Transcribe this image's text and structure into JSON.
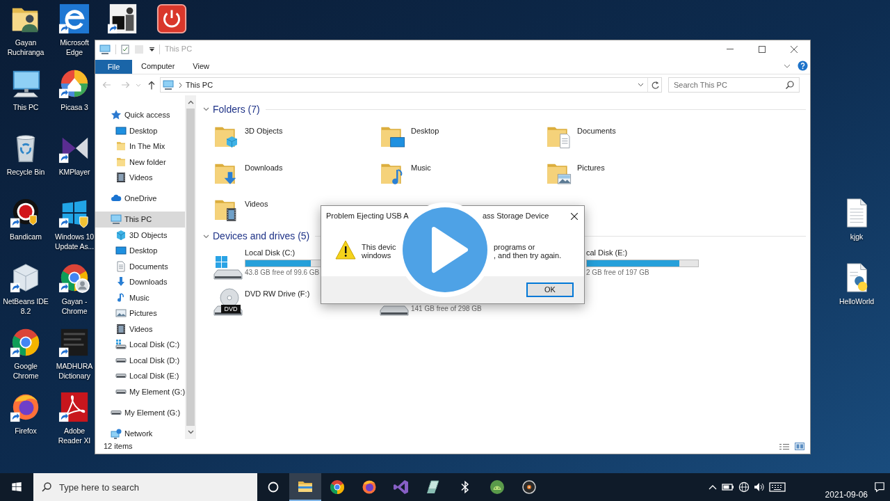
{
  "desktop": {
    "column_1": [
      {
        "label": "Gayan Ruchiranga",
        "kind": "user-folder",
        "shortcut": false
      },
      {
        "label": "This PC",
        "kind": "computer",
        "shortcut": false
      },
      {
        "label": "Recycle Bin",
        "kind": "recycle-bin",
        "shortcut": false
      },
      {
        "label": "Bandicam",
        "kind": "record",
        "shortcut": true
      },
      {
        "label": "NetBeans IDE 8.2",
        "kind": "cube",
        "shortcut": true
      },
      {
        "label": "Google Chrome",
        "kind": "browser",
        "shortcut": true
      },
      {
        "label": "Firefox",
        "kind": "fox",
        "shortcut": true
      }
    ],
    "column_2": [
      {
        "label": "Microsoft Edge",
        "kind": "e-logo",
        "shortcut": true
      },
      {
        "label": "Picasa 3",
        "kind": "pinwheel",
        "shortcut": true
      },
      {
        "label": "KMPlayer",
        "kind": "bowtie",
        "shortcut": true
      },
      {
        "label": "Windows 10 Update As...",
        "kind": "windows",
        "shortcut": true
      },
      {
        "label": "Gayan - Chrome",
        "kind": "browser-profile",
        "shortcut": true
      },
      {
        "label": "MADHURA Dictionary",
        "kind": "tile",
        "shortcut": true
      },
      {
        "label": "Adobe Reader XI",
        "kind": "pdf",
        "shortcut": true
      }
    ],
    "top_row": [
      {
        "kind": "picture",
        "shortcut": true
      },
      {
        "kind": "power",
        "shortcut": false
      }
    ],
    "right_side": [
      {
        "label": "kjgk",
        "kind": "text-file",
        "shortcut": false
      },
      {
        "label": "HelloWorld",
        "kind": "script-file",
        "shortcut": false
      }
    ]
  },
  "explorer": {
    "title": "This PC",
    "ribbon": {
      "file_tab": "File",
      "tabs": [
        {
          "label": "Computer",
          "selected": false
        },
        {
          "label": "View",
          "selected": false
        }
      ]
    },
    "address": {
      "crumbs": [
        "This PC"
      ]
    },
    "search": {
      "placeholder": "Search This PC"
    },
    "nav": [
      {
        "label": "Quick access",
        "kind": "star",
        "selected": false,
        "children": [
          {
            "label": "Desktop",
            "kind": "desktop",
            "selected": false
          },
          {
            "label": "In The Mix",
            "kind": "folder",
            "selected": false
          },
          {
            "label": "New folder",
            "kind": "folder",
            "selected": false
          },
          {
            "label": "Videos",
            "kind": "videos",
            "selected": false
          }
        ]
      },
      {
        "label": "OneDrive",
        "kind": "cloud",
        "selected": false
      },
      {
        "label": "This PC",
        "kind": "pc",
        "selected": true,
        "children": [
          {
            "label": "3D Objects",
            "kind": "cube",
            "selected": false
          },
          {
            "label": "Desktop",
            "kind": "desktop",
            "selected": false
          },
          {
            "label": "Documents",
            "kind": "documents",
            "selected": false
          },
          {
            "label": "Downloads",
            "kind": "downloads",
            "selected": false
          },
          {
            "label": "Music",
            "kind": "music",
            "selected": false
          },
          {
            "label": "Pictures",
            "kind": "pictures",
            "selected": false
          },
          {
            "label": "Videos",
            "kind": "videos",
            "selected": false
          },
          {
            "label": "Local Disk (C:)",
            "kind": "system-drive",
            "selected": false
          },
          {
            "label": "Local Disk (D:)",
            "kind": "drive",
            "selected": false
          },
          {
            "label": "Local Disk (E:)",
            "kind": "drive",
            "selected": false
          },
          {
            "label": "My Element (G:)",
            "kind": "drive",
            "selected": false
          }
        ]
      },
      {
        "label": "My Element (G:)",
        "kind": "drive",
        "selected": false
      },
      {
        "label": "Network",
        "kind": "network",
        "selected": false
      }
    ],
    "sections": [
      {
        "title": "Folders (7)",
        "kind": "folders",
        "expanded": true,
        "items": [
          {
            "label": "3D Objects",
            "kind": "cube"
          },
          {
            "label": "Desktop",
            "kind": "desktop"
          },
          {
            "label": "Documents",
            "kind": "documents"
          },
          {
            "label": "Downloads",
            "kind": "downloads"
          },
          {
            "label": "Music",
            "kind": "music"
          },
          {
            "label": "Pictures",
            "kind": "pictures"
          },
          {
            "label": "Videos",
            "kind": "videos"
          }
        ]
      },
      {
        "title": "Devices and drives (5)",
        "kind": "drives",
        "expanded": true,
        "items": [
          {
            "name": "Local Disk (C:)",
            "kind": "system-disk",
            "level": 0.59,
            "free": "43.8 GB free of 99.6 GB"
          },
          {
            "name": "cal Disk (E:)",
            "level": 0.83,
            "free": "2 GB free of 197 GB"
          },
          {
            "name": "DVD RW Drive (F:)",
            "kind": "dvd",
            "disc_label": "DVD"
          },
          {
            "kind": "disk",
            "free": "141 GB free of 298 GB"
          }
        ]
      }
    ],
    "status": "12 items"
  },
  "dialog": {
    "title_fragments": [
      "Problem Ejecting USB A",
      "ass Storage Device"
    ],
    "message_left": [
      "This devic",
      "windows"
    ],
    "message_right": [
      "programs or",
      ", and then try again."
    ],
    "button": {
      "label": "OK",
      "focused": true
    }
  },
  "taskbar": {
    "search": {
      "placeholder": "Type here to search"
    },
    "apps": [
      {
        "kind": "folder",
        "active": true
      },
      {
        "kind": "browser",
        "active": false
      },
      {
        "kind": "fox",
        "active": false
      },
      {
        "kind": "ribbon",
        "active": false
      },
      {
        "kind": "gem",
        "active": false
      },
      {
        "kind": "bluetooth",
        "active": false
      },
      {
        "kind": "robot",
        "active": false
      },
      {
        "kind": "disc",
        "active": false
      }
    ],
    "date": "2021-09-06"
  }
}
